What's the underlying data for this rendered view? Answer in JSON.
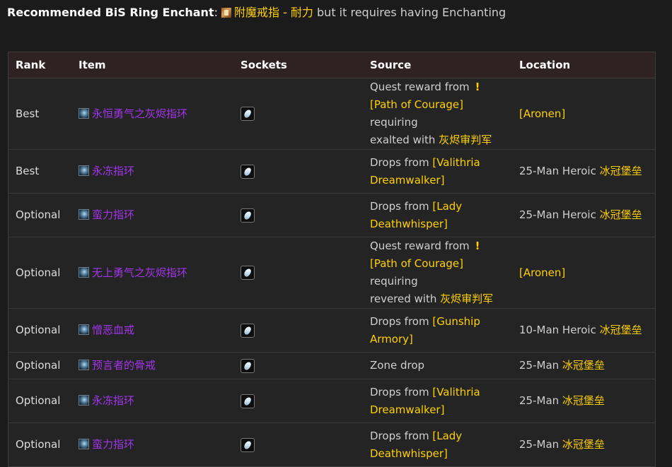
{
  "recommend": {
    "label": "Recommended BiS Ring Enchant",
    "colon": ":",
    "enchant_icon": "enchant-scroll-icon",
    "enchant_name": "附魔戒指 - 耐力",
    "suffix": " but it requires having Enchanting"
  },
  "table": {
    "headers": [
      "Rank",
      "Item",
      "Sockets",
      "Source",
      "Location"
    ],
    "rows": [
      {
        "rank": "Best",
        "item": "永恒勇气之灰烬指环",
        "source_pre": "Quest reward from",
        "source_quest_icon": "!",
        "source_link": "[Path of Courage]",
        "source_mid": " requiring",
        "source_post": "exalted with ",
        "source_faction": "灰烬审判军",
        "location_pre": "",
        "location_link": "[Aronen]"
      },
      {
        "rank": "Best",
        "item": "永冻指环",
        "source_pre": "Drops from ",
        "source_link": "[Valithria Dreamwalker]",
        "location_pre": "25-Man Heroic ",
        "location_link": "冰冠堡垒"
      },
      {
        "rank": "Optional",
        "item": "蛮力指环",
        "source_pre": "Drops from ",
        "source_link": "[Lady Deathwhisper]",
        "location_pre": "25-Man Heroic ",
        "location_link": "冰冠堡垒"
      },
      {
        "rank": "Optional",
        "item": "无上勇气之灰烬指环",
        "source_pre": "Quest reward from",
        "source_quest_icon": "!",
        "source_link": "[Path of Courage]",
        "source_mid": " requiring",
        "source_post": "revered with ",
        "source_faction": "灰烬审判军",
        "location_pre": "",
        "location_link": "[Aronen]"
      },
      {
        "rank": "Optional",
        "item": "憎恶血戒",
        "source_pre": "Drops from ",
        "source_link": "[Gunship Armory]",
        "location_pre": "10-Man Heroic ",
        "location_link": "冰冠堡垒"
      },
      {
        "rank": "Optional",
        "item": "预言者的骨戒",
        "source_pre": "Zone drop",
        "source_link": "",
        "location_pre": "25-Man ",
        "location_link": "冰冠堡垒"
      },
      {
        "rank": "Optional",
        "item": "永冻指环",
        "source_pre": "Drops from ",
        "source_link": "[Valithria Dreamwalker]",
        "location_pre": "25-Man ",
        "location_link": "冰冠堡垒"
      },
      {
        "rank": "Optional",
        "item": "蛮力指环",
        "source_pre": "Drops from ",
        "source_link": "[Lady Deathwhisper]",
        "location_pre": "25-Man ",
        "location_link": "冰冠堡垒"
      }
    ]
  },
  "icons": {
    "item": "ring-item-icon",
    "socket": "prismatic-socket-gem-icon",
    "quest": "quest-exclamation-icon"
  },
  "colors": {
    "epic_purple": "#a335ee",
    "link_gold": "#ffd100",
    "header_bg": "#2f2224",
    "row_bg": "#242424"
  }
}
